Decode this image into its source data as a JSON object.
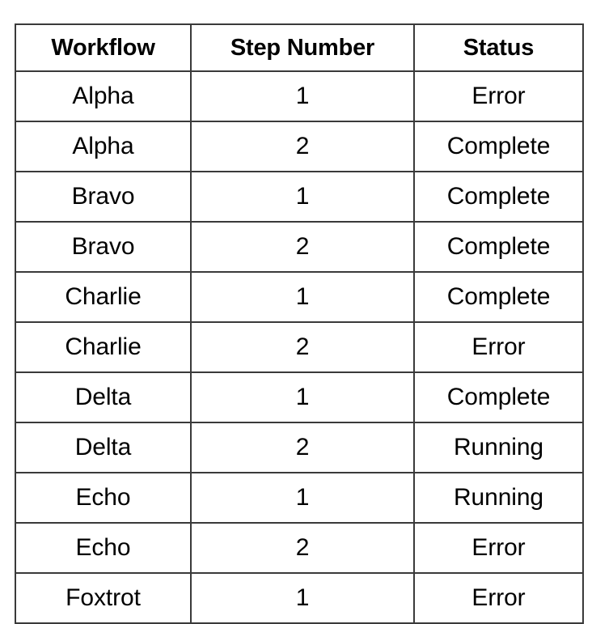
{
  "table": {
    "columns": [
      "Workflow",
      "Step Number",
      "Status"
    ],
    "rows": [
      {
        "workflow": "Alpha",
        "step_number": "1",
        "status": "Error"
      },
      {
        "workflow": "Alpha",
        "step_number": "2",
        "status": "Complete"
      },
      {
        "workflow": "Bravo",
        "step_number": "1",
        "status": "Complete"
      },
      {
        "workflow": "Bravo",
        "step_number": "2",
        "status": "Complete"
      },
      {
        "workflow": "Charlie",
        "step_number": "1",
        "status": "Complete"
      },
      {
        "workflow": "Charlie",
        "step_number": "2",
        "status": "Error"
      },
      {
        "workflow": "Delta",
        "step_number": "1",
        "status": "Complete"
      },
      {
        "workflow": "Delta",
        "step_number": "2",
        "status": "Running"
      },
      {
        "workflow": "Echo",
        "step_number": "1",
        "status": "Running"
      },
      {
        "workflow": "Echo",
        "step_number": "2",
        "status": "Error"
      },
      {
        "workflow": "Foxtrot",
        "step_number": "1",
        "status": "Error"
      }
    ]
  },
  "colors": {
    "background": "#ffffff",
    "text": "#000000",
    "border": "#3a3a3a"
  }
}
